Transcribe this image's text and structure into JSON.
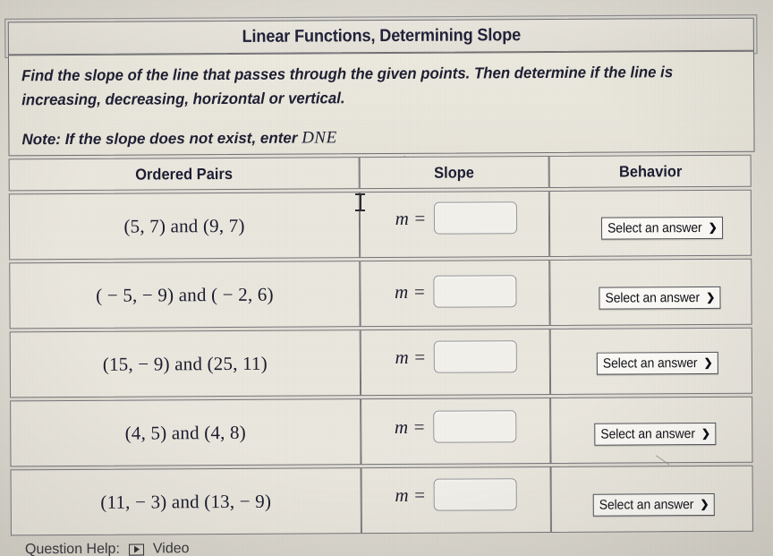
{
  "title": "Linear Functions, Determining Slope",
  "instructions": {
    "line1": "Find the slope of the line that passes through the given points. Then determine if the line is",
    "line2": "increasing, decreasing, horizontal or vertical.",
    "note_label": "Note:",
    "note_text": "If the slope does not exist, enter",
    "note_math": "DNE"
  },
  "table": {
    "headers": [
      "Ordered Pairs",
      "Slope",
      "Behavior"
    ],
    "slope_prefix": "m =",
    "select_placeholder": "Select an answer",
    "select_chevron": "chevron-down-icon",
    "rows": [
      {
        "pairs": "(5, 7) and (9, 7)",
        "slope_value": "",
        "behavior_value": "Select an answer"
      },
      {
        "pairs": "( − 5,  − 9) and ( − 2, 6)",
        "slope_value": "",
        "behavior_value": "Select an answer"
      },
      {
        "pairs": "(15,  − 9) and (25, 11)",
        "slope_value": "",
        "behavior_value": "Select an answer"
      },
      {
        "pairs": "(4, 5) and (4, 8)",
        "slope_value": "",
        "behavior_value": "Select an answer"
      },
      {
        "pairs": "(11,  − 3) and (13,  − 9)",
        "slope_value": "",
        "behavior_value": "Select an answer"
      }
    ]
  },
  "footer": {
    "help_label": "Question Help:",
    "video_label": "Video",
    "video_icon": "play-video-icon"
  },
  "colors": {
    "paper": "#e6e3da",
    "cell": "#eae7de",
    "border": "#75757a",
    "title_text": "#22223a",
    "select_bg": "#fbfaf6"
  }
}
